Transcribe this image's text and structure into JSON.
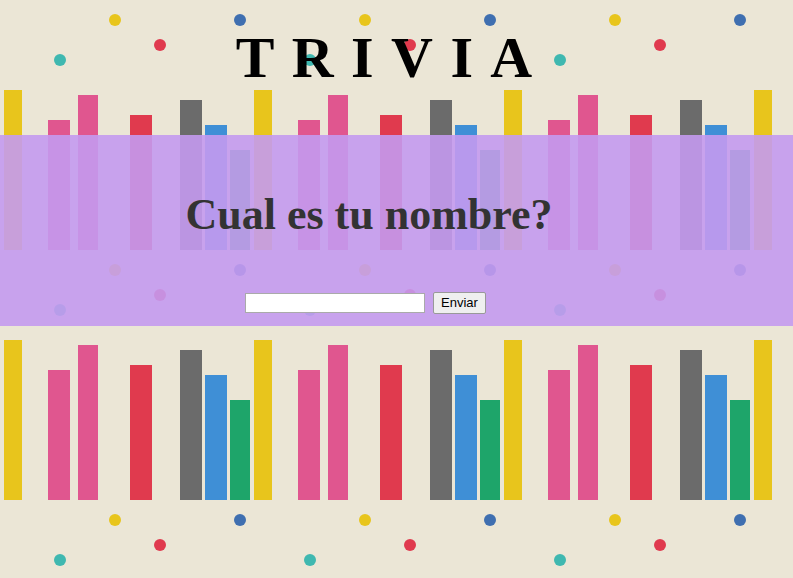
{
  "title": "TRIVIA",
  "question": "Cual es tu nombre?",
  "name_input": {
    "value": ""
  },
  "submit_button": {
    "label": "Enviar"
  }
}
